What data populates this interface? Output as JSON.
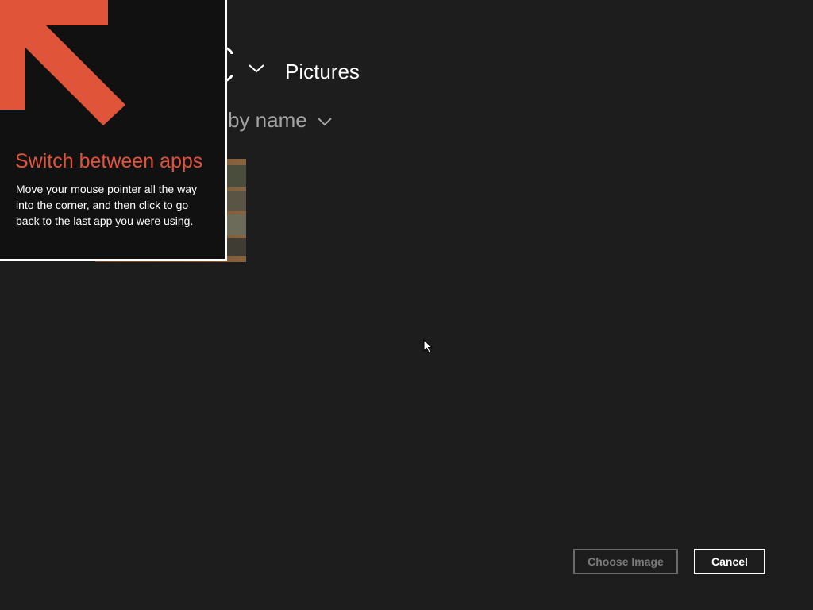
{
  "picker": {
    "location": "Pictures",
    "sort_label": "by name"
  },
  "tip": {
    "title": "Switch between apps",
    "body": "Move your mouse pointer all the way into the corner, and then click to go back to the last app you were using.",
    "arrow_icon": "arrow-up-left-icon"
  },
  "buttons": {
    "choose_label": "Choose Image",
    "cancel_label": "Cancel"
  },
  "colors": {
    "background": "#1d1d1d",
    "accent": "#e0553a",
    "disabled_text": "#7a7a7a"
  },
  "state": {
    "choose_enabled": false
  }
}
